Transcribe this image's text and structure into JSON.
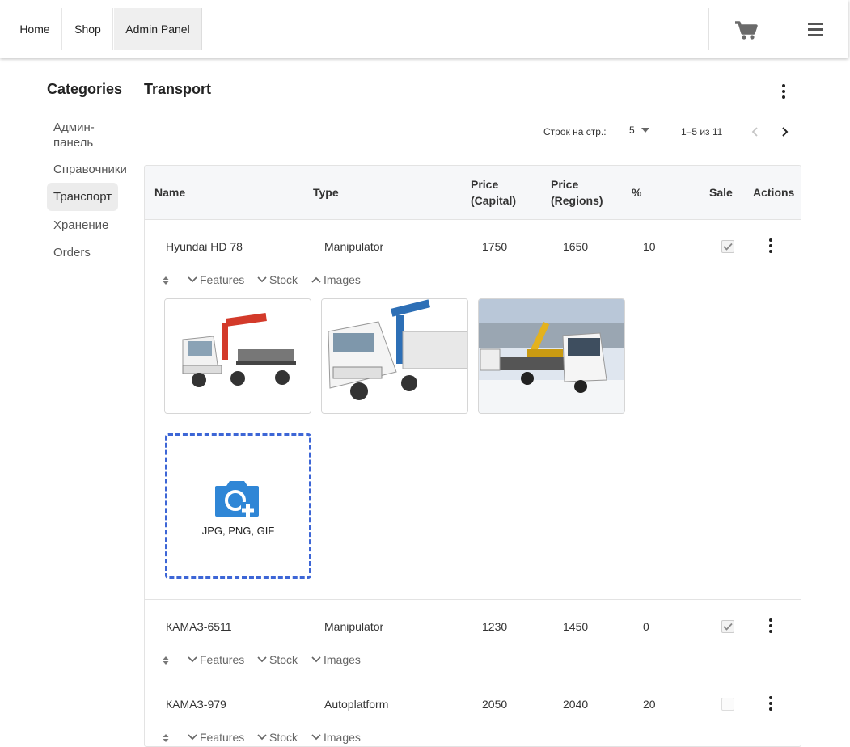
{
  "nav": {
    "home": "Home",
    "shop": "Shop",
    "admin": "Admin Panel",
    "cart_icon": "cart-icon",
    "menu_icon": "hamburger-menu-icon"
  },
  "sidebar": {
    "title": "Categories",
    "items": [
      {
        "label": "Админ-"
      },
      {
        "label": "панель"
      },
      {
        "label": "Справочники"
      },
      {
        "label": "Транспорт"
      },
      {
        "label": "Хранение"
      },
      {
        "label": "Orders"
      }
    ],
    "active": "Транспорт"
  },
  "main": {
    "title": "Transport"
  },
  "pager": {
    "rows_label": "Строк на стр.:",
    "rows_value": "5",
    "range": "1–5 из 11"
  },
  "table": {
    "headers": {
      "name": "Name",
      "type": "Type",
      "price_capital_1": "Price",
      "price_capital_2": "(Capital)",
      "price_regions_1": "Price",
      "price_regions_2": "(Regions)",
      "percent": "%",
      "sale": "Sale",
      "actions": "Actions"
    },
    "rows": [
      {
        "name": "Hyundai HD 78",
        "type": "Manipulator",
        "price_capital": "1750",
        "price_regions": "1650",
        "percent": "10",
        "sale": true
      },
      {
        "name": "КАМАЗ-6511",
        "type": "Manipulator",
        "price_capital": "1230",
        "price_regions": "1450",
        "percent": "0",
        "sale": true
      },
      {
        "name": "КАМАЗ-979",
        "type": "Autoplatform",
        "price_capital": "2050",
        "price_regions": "2040",
        "percent": "20",
        "sale": false
      }
    ],
    "toggles": {
      "features": "Features",
      "stock": "Stock",
      "images": "Images"
    },
    "upload": {
      "formats": "JPG, PNG, GIF"
    }
  },
  "colors": {
    "accent": "#2f86d6",
    "upload_border": "#3d66d6",
    "header_bg": "#f6f7f9",
    "active_nav_bg": "#efefef"
  }
}
